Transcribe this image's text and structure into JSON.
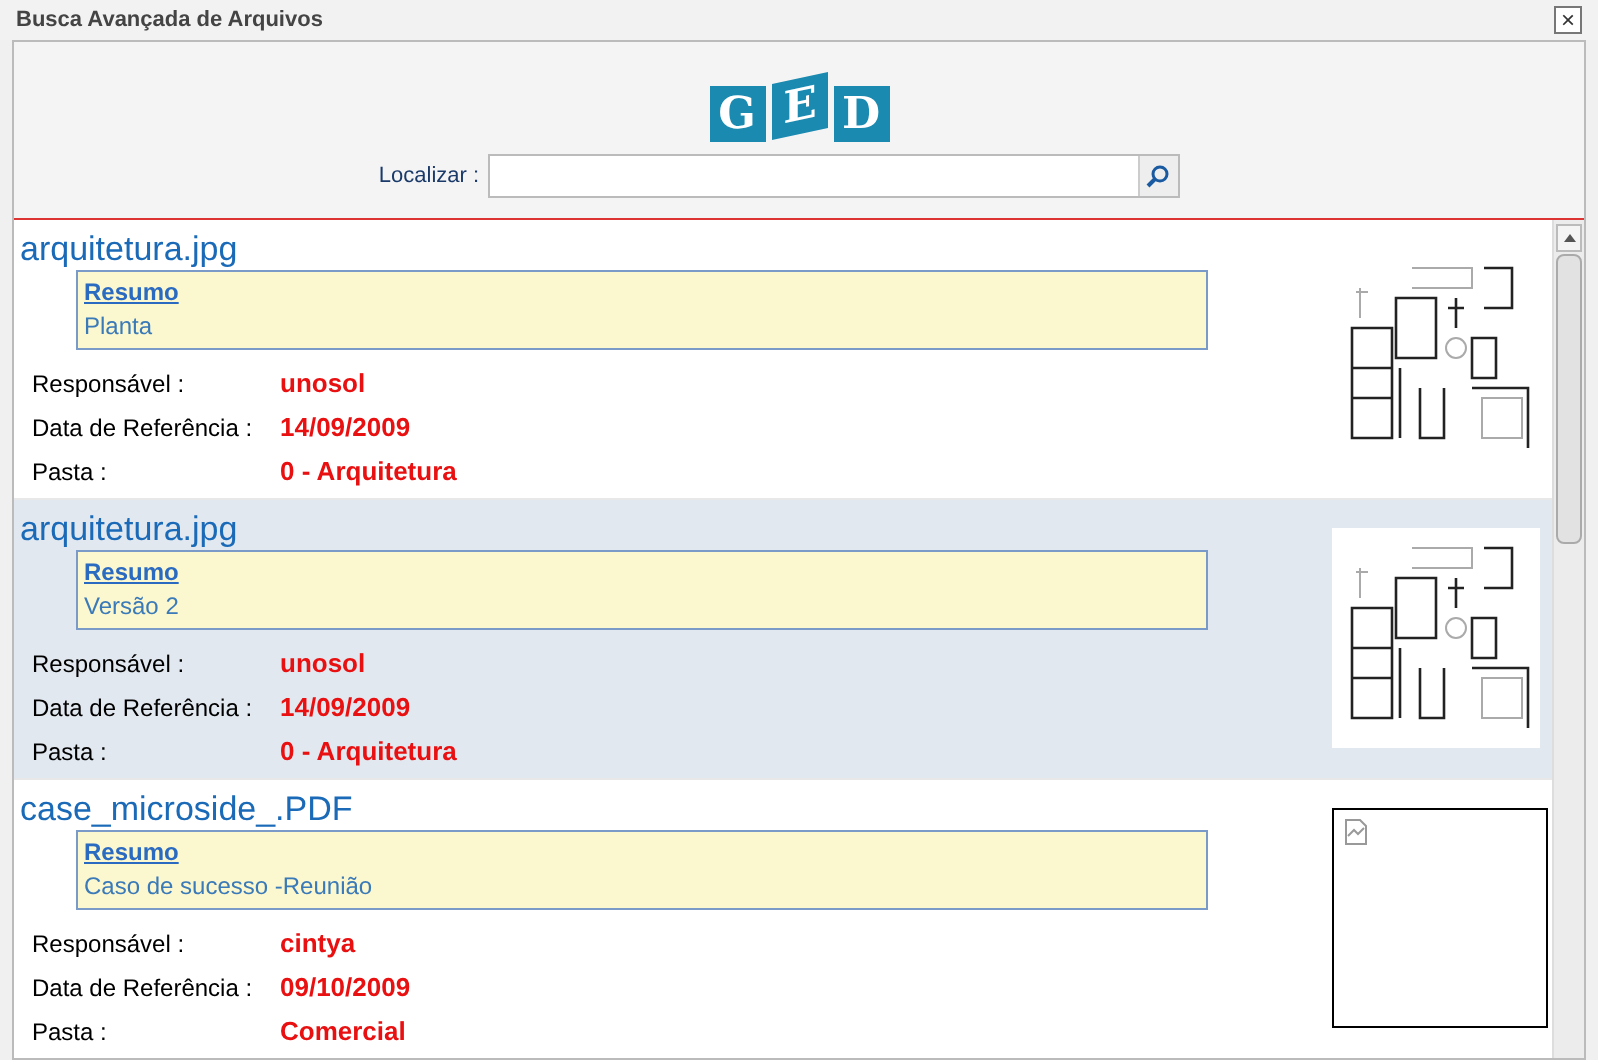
{
  "window": {
    "title": "Busca Avançada de Arquivos",
    "close": "×"
  },
  "logo": {
    "letters": [
      "G",
      "E",
      "D"
    ]
  },
  "search": {
    "label": "Localizar :"
  },
  "results": [
    {
      "filename": "arquitetura.jpg",
      "highlighted": false,
      "summary_title": "Resumo",
      "summary": "Planta",
      "fields": [
        {
          "label": "Responsável :",
          "value": "unosol"
        },
        {
          "label": "Data de Referência :",
          "value": "14/09/2009"
        },
        {
          "label": "Pasta :",
          "value": "0 - Arquitetura"
        }
      ],
      "thumbnail": {
        "kind": "plan"
      }
    },
    {
      "filename": "arquitetura.jpg",
      "highlighted": true,
      "summary_title": "Resumo",
      "summary": "Versão 2",
      "fields": [
        {
          "label": "Responsável :",
          "value": "unosol"
        },
        {
          "label": "Data de Referência :",
          "value": "14/09/2009"
        },
        {
          "label": "Pasta :",
          "value": "0 - Arquitetura"
        }
      ],
      "thumbnail": {
        "kind": "plan"
      }
    },
    {
      "filename": "case_microside_.PDF",
      "highlighted": false,
      "summary_title": "Resumo",
      "summary": "Caso de sucesso -Reunião",
      "fields": [
        {
          "label": "Responsável :",
          "value": "cintya"
        },
        {
          "label": "Data de Referência :",
          "value": "09/10/2009"
        },
        {
          "label": "Pasta :",
          "value": "Comercial"
        }
      ],
      "thumbnail": {
        "kind": "broken"
      }
    }
  ]
}
